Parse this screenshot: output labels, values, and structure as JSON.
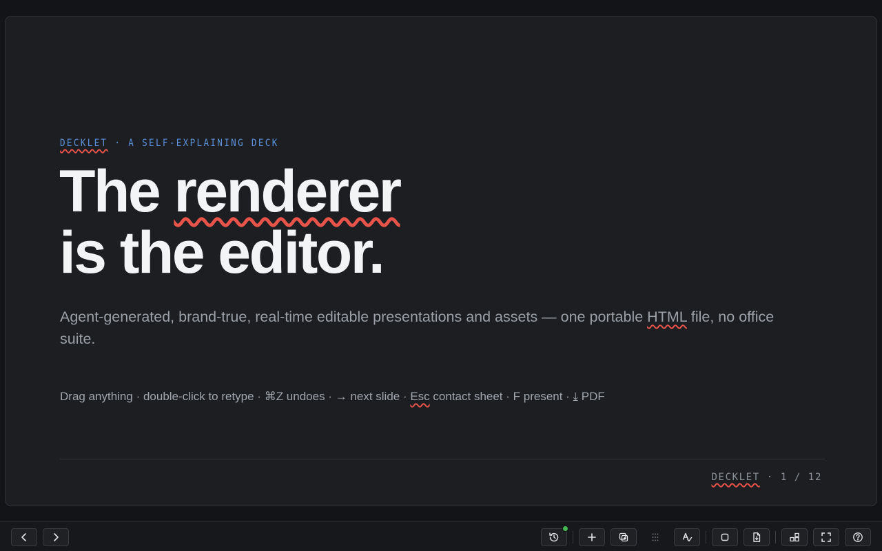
{
  "slide": {
    "eyebrow_brand": "DECKLET",
    "eyebrow_rest": " · A SELF-EXPLAINING DECK",
    "title_the": "The ",
    "title_renderer": "renderer",
    "title_line2": "is the editor.",
    "subtitle_before": "Agent-generated, brand-true, real-time editable presentations and assets — one portable ",
    "subtitle_html": "HTML",
    "subtitle_after": " file, no office suite.",
    "hint_before": "Drag anything · double-click to retype · ⌘Z undoes · → next slide · ",
    "hint_esc": "Esc",
    "hint_after": " contact sheet · F present · ⤓ PDF",
    "footer_brand": "DECKLET",
    "footer_page": " · 1 / 12"
  },
  "toolbar": {
    "buttons": [
      {
        "name": "prev-slide-button",
        "icon": "chevron-left-icon"
      },
      {
        "name": "next-slide-button",
        "icon": "chevron-right-icon"
      },
      {
        "name": "history-button",
        "icon": "history-icon",
        "status": "saved"
      },
      {
        "name": "add-slide-button",
        "icon": "plus-icon"
      },
      {
        "name": "duplicate-slide-button",
        "icon": "duplicate-icon"
      },
      {
        "name": "grid-button",
        "icon": "grid-dots-icon",
        "disabled": true
      },
      {
        "name": "spellcheck-button",
        "icon": "spellcheck-icon"
      },
      {
        "name": "frame-button",
        "icon": "square-icon"
      },
      {
        "name": "export-button",
        "icon": "file-export-icon"
      },
      {
        "name": "layout-button",
        "icon": "layout-icon"
      },
      {
        "name": "fullscreen-button",
        "icon": "fullscreen-icon"
      },
      {
        "name": "help-button",
        "icon": "help-icon"
      }
    ]
  },
  "colors": {
    "accent": "#5d92dc",
    "squiggle": "#e8534a",
    "status_ok": "#3fb950"
  }
}
